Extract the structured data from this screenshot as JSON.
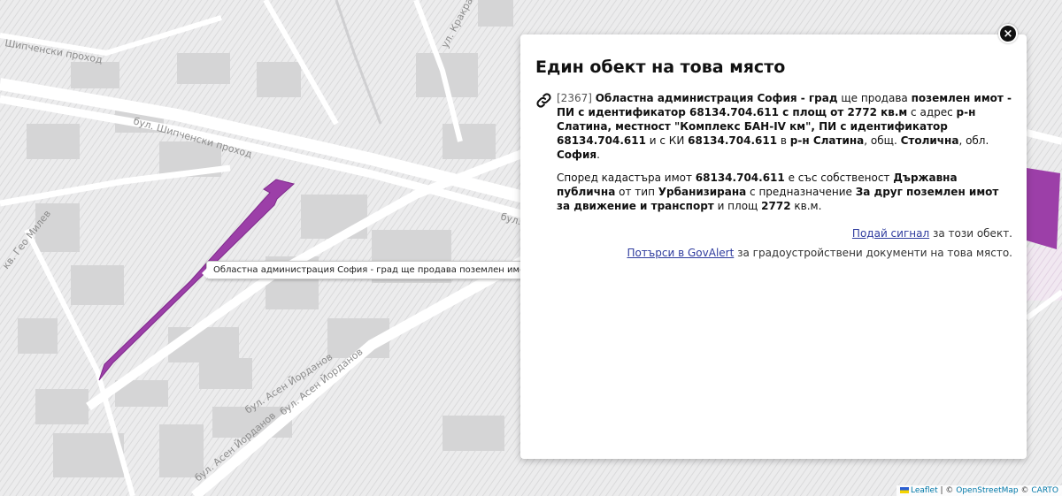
{
  "map": {
    "street_labels": [
      "бул. Шипченски проход",
      "бул. Асен Йорданов",
      "бул. Асен Йорданов",
      "бул. Асен Йорданов",
      "ул. Кракра",
      "бул. Ш",
      "кв. Гео Милев",
      "Шипченски проход"
    ],
    "highlight_color": "#9c3fa8"
  },
  "tooltip": {
    "text": "Областна администрация София - град ще продава поземлен имот"
  },
  "panel": {
    "title": "Един обект на това място",
    "close_symbol": "×",
    "p1": {
      "id": "[2367]",
      "org": "Областна администрация София - град",
      "t1": " ще продава ",
      "b1": "поземлен имот - ПИ с идентификатор 68134.704.611 с площ от 2772 кв.м",
      "t2": " с адрес ",
      "b2": "р-н Слатина, местност \"Комплекс БАН-IV км\", ПИ с идентификатор 68134.704.611",
      "t3": " и с КИ ",
      "b3": "68134.704.611",
      "t4": " в ",
      "b4": "р-н Слатина",
      "t5": ", общ. ",
      "b5": "Столична",
      "t6": ", обл. ",
      "b6": "София",
      "t7": "."
    },
    "p2": {
      "t1": "Според кадастъра имот ",
      "b1": "68134.704.611",
      "t2": " е със собственост ",
      "b2": "Държавна публична",
      "t3": " от тип ",
      "b3": "Урбанизирана",
      "t4": " с предназначение ",
      "b4": "За друг поземлен имот за движение и транспорт",
      "t5": " и площ ",
      "b5": "2772",
      "t6": " кв.м."
    },
    "report": {
      "link": "Подай сигнал",
      "rest": " за този обект."
    },
    "search": {
      "link": "Потърси в GovAlert",
      "rest": " за градоустройствени документи на това място."
    }
  },
  "attribution": {
    "leaflet": "Leaflet",
    "sep1": " | © ",
    "osm": "OpenStreetMap",
    "sep2": " © ",
    "carto": "CARTO"
  }
}
